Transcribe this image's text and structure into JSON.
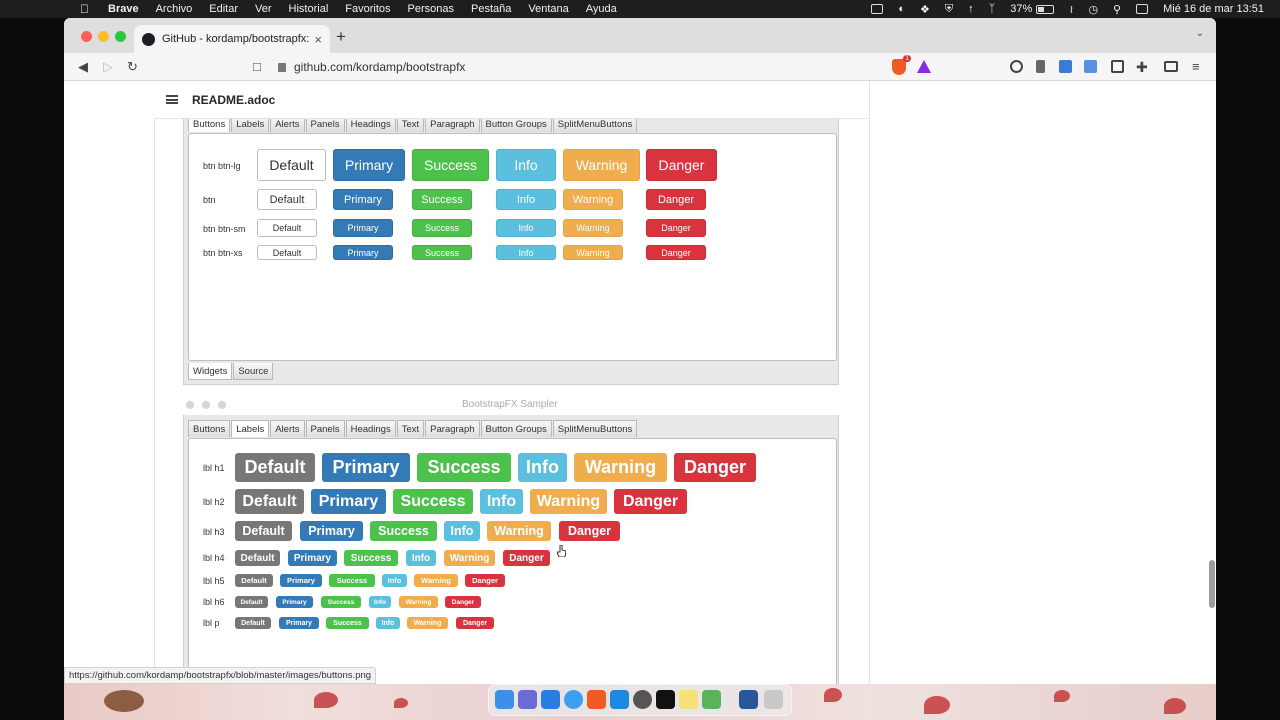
{
  "menubar": {
    "app": "Brave",
    "items": [
      "Archivo",
      "Editar",
      "Ver",
      "Historial",
      "Favoritos",
      "Personas",
      "Pestaña",
      "Ventana",
      "Ayuda"
    ],
    "battery": "37%",
    "datetime": "Mié 16 de mar  13:51"
  },
  "browser": {
    "tab_title": "GitHub - kordamp/bootstrapfx:",
    "new_tab": "+",
    "url": "github.com/kordamp/bootstrapfx",
    "shield_badge": "1"
  },
  "readme": {
    "file": "README.adoc"
  },
  "sampler1": {
    "tabs": [
      "Buttons",
      "Labels",
      "Alerts",
      "Panels",
      "Headings",
      "Text",
      "Paragraph",
      "Button Groups",
      "SplitMenuButtons"
    ],
    "rows": [
      {
        "label": "btn btn-lg",
        "buttons": [
          "Default",
          "Primary",
          "Success",
          "Info",
          "Warning",
          "Danger"
        ]
      },
      {
        "label": "btn",
        "buttons": [
          "Default",
          "Primary",
          "Success",
          "Info",
          "Warning",
          "Danger"
        ]
      },
      {
        "label": "btn btn-sm",
        "buttons": [
          "Default",
          "Primary",
          "Success",
          "Info",
          "Warning",
          "Danger"
        ]
      },
      {
        "label": "btn btn-xs",
        "buttons": [
          "Default",
          "Primary",
          "Success",
          "Info",
          "Warning",
          "Danger"
        ]
      }
    ],
    "bottom_tabs": [
      "Widgets",
      "Source"
    ]
  },
  "sampler2": {
    "window_title": "BootstrapFX Sampler",
    "tabs": [
      "Buttons",
      "Labels",
      "Alerts",
      "Panels",
      "Headings",
      "Text",
      "Paragraph",
      "Button Groups",
      "SplitMenuButtons"
    ],
    "rows": [
      {
        "label": "lbl h1",
        "items": [
          "Default",
          "Primary",
          "Success",
          "Info",
          "Warning",
          "Danger"
        ]
      },
      {
        "label": "lbl h2",
        "items": [
          "Default",
          "Primary",
          "Success",
          "Info",
          "Warning",
          "Danger"
        ]
      },
      {
        "label": "lbl h3",
        "items": [
          "Default",
          "Primary",
          "Success",
          "Info",
          "Warning",
          "Danger"
        ]
      },
      {
        "label": "lbl h4",
        "items": [
          "Default",
          "Primary",
          "Success",
          "Info",
          "Warning",
          "Danger"
        ]
      },
      {
        "label": "lbl h5",
        "items": [
          "Default",
          "Primary",
          "Success",
          "Info",
          "Warning",
          "Danger"
        ]
      },
      {
        "label": "lbl h6",
        "items": [
          "Default",
          "Primary",
          "Success",
          "Info",
          "Warning",
          "Danger"
        ]
      },
      {
        "label": "lbl p",
        "items": [
          "Default",
          "Primary",
          "Success",
          "Info",
          "Warning",
          "Danger"
        ]
      }
    ]
  },
  "status_url": "https://github.com/kordamp/bootstrapfx/blob/master/images/buttons.png",
  "colors": {
    "default": "#ffffff",
    "primary": "#337ab7",
    "success": "#4cc24c",
    "info": "#5bc0de",
    "warning": "#f0ad4e",
    "danger": "#d9343e",
    "label_default": "#777777"
  },
  "icons": [
    "apple-icon",
    "github-icon",
    "brave-shield-icon",
    "brave-rewards-icon",
    "extensions-icon",
    "wallet-icon",
    "menu-icon"
  ]
}
